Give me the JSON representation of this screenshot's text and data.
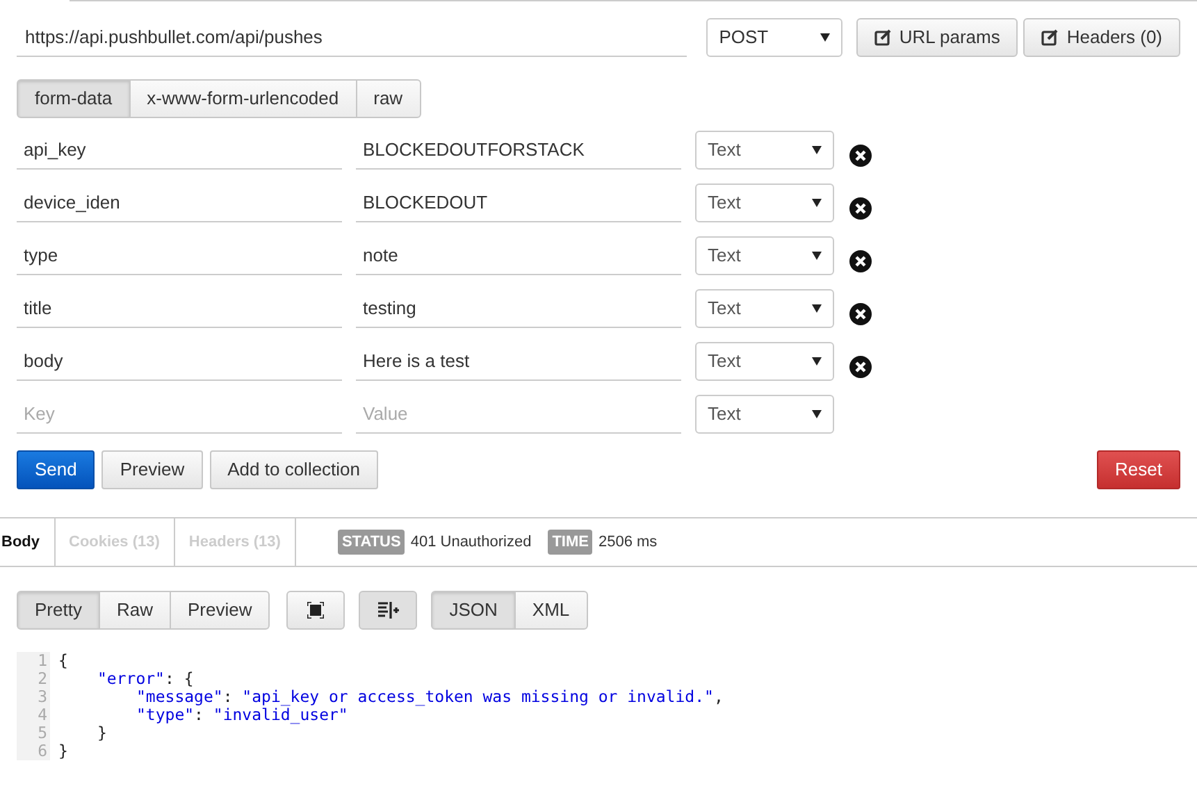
{
  "request": {
    "url": "https://api.pushbullet.com/api/pushes",
    "method": "POST",
    "buttons": [
      "URL params",
      "Headers (0)"
    ]
  },
  "body_tabs": [
    {
      "label": "form-data",
      "selected": true
    },
    {
      "label": "x-www-form-urlencoded",
      "selected": false
    },
    {
      "label": "raw",
      "selected": false
    }
  ],
  "params": [
    {
      "key": "api_key",
      "value": "BLOCKEDOUTFORSTACK",
      "type": "Text",
      "removable": true
    },
    {
      "key": "device_iden",
      "value": "BLOCKEDOUT",
      "type": "Text",
      "removable": true
    },
    {
      "key": "type",
      "value": "note",
      "type": "Text",
      "removable": true
    },
    {
      "key": "title",
      "value": "testing",
      "type": "Text",
      "removable": true
    },
    {
      "key": "body",
      "value": "Here is a test",
      "type": "Text",
      "removable": true
    },
    {
      "key_placeholder": "Key",
      "value_placeholder": "Value",
      "type": "Text",
      "removable": false
    }
  ],
  "actions": [
    {
      "label": "Send",
      "kind": "primary"
    },
    {
      "label": "Preview",
      "kind": "default"
    },
    {
      "label": "Add to collection",
      "kind": "default"
    },
    {
      "label": "Reset",
      "kind": "danger"
    }
  ],
  "response_tabs": [
    {
      "label": "Body",
      "selected": true
    },
    {
      "label": "Cookies (13)",
      "selected": false
    },
    {
      "label": "Headers (13)",
      "selected": false
    }
  ],
  "status": {
    "label": "STATUS",
    "value": "401 Unauthorized"
  },
  "time": {
    "label": "TIME",
    "value": "2506 ms"
  },
  "view_modes": [
    {
      "label": "Pretty",
      "selected": true
    },
    {
      "label": "Raw",
      "selected": false
    },
    {
      "label": "Preview",
      "selected": false
    }
  ],
  "formats": [
    {
      "label": "JSON",
      "selected": true
    },
    {
      "label": "XML",
      "selected": false
    }
  ],
  "code_lines": [
    {
      "number": "1",
      "tokens": [
        {
          "kind": "punct",
          "text": "{"
        }
      ]
    },
    {
      "number": "2",
      "kind": "nested",
      "tokens": [
        {
          "kind": "key",
          "text": "\"error\""
        },
        {
          "kind": "punct",
          "text": ": {"
        }
      ]
    },
    {
      "number": "3",
      "kind": "deep",
      "tokens": [
        {
          "kind": "key",
          "text": "\"message\""
        },
        {
          "kind": "punct",
          "text": ": "
        },
        {
          "kind": "string",
          "text": "\"api_key or access_token was missing or invalid.\""
        },
        {
          "kind": "punct",
          "text": ","
        }
      ]
    },
    {
      "number": "4",
      "kind": "deep",
      "tokens": [
        {
          "kind": "key",
          "text": "\"type\""
        },
        {
          "kind": "punct",
          "text": ": "
        },
        {
          "kind": "string",
          "text": "\"invalid_user\""
        }
      ]
    },
    {
      "number": "5",
      "kind": "nested",
      "tokens": [
        {
          "kind": "punct",
          "text": "}"
        }
      ]
    },
    {
      "number": "6",
      "tokens": [
        {
          "kind": "punct",
          "text": "}"
        }
      ]
    }
  ]
}
